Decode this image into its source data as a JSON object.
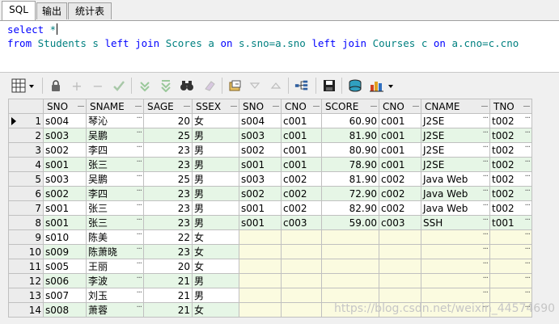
{
  "tabs": [
    "SQL",
    "输出",
    "统计表"
  ],
  "editor": {
    "line1": {
      "kw": "select",
      "rest": " *"
    },
    "line2": [
      "from",
      " ",
      "Students",
      " s ",
      "left join",
      " ",
      "Scores",
      " a ",
      "on",
      " s.sno=a.sno ",
      "left join",
      " ",
      "Courses",
      " c ",
      "on",
      " a.cno=c.cno"
    ]
  },
  "columns": [
    "SNO",
    "SNAME",
    "SAGE",
    "SSEX",
    "SNO",
    "CNO",
    "SCORE",
    "CNO",
    "CNAME",
    "TNO"
  ],
  "rows": [
    [
      "1",
      "s004",
      "琴沁",
      "20",
      "女",
      "s004",
      "c001",
      "60.90",
      "c001",
      "J2SE",
      "t002"
    ],
    [
      "2",
      "s003",
      "吴鹏",
      "25",
      "男",
      "s003",
      "c001",
      "81.90",
      "c001",
      "J2SE",
      "t002"
    ],
    [
      "3",
      "s002",
      "李四",
      "23",
      "男",
      "s002",
      "c001",
      "80.90",
      "c001",
      "J2SE",
      "t002"
    ],
    [
      "4",
      "s001",
      "张三",
      "23",
      "男",
      "s001",
      "c001",
      "78.90",
      "c001",
      "J2SE",
      "t002"
    ],
    [
      "5",
      "s003",
      "吴鹏",
      "25",
      "男",
      "s003",
      "c002",
      "81.90",
      "c002",
      "Java Web",
      "t002"
    ],
    [
      "6",
      "s002",
      "李四",
      "23",
      "男",
      "s002",
      "c002",
      "72.90",
      "c002",
      "Java Web",
      "t002"
    ],
    [
      "7",
      "s001",
      "张三",
      "23",
      "男",
      "s001",
      "c002",
      "82.90",
      "c002",
      "Java Web",
      "t002"
    ],
    [
      "8",
      "s001",
      "张三",
      "23",
      "男",
      "s001",
      "c003",
      "59.00",
      "c003",
      "SSH",
      "t001"
    ],
    [
      "9",
      "s010",
      "陈美",
      "22",
      "女",
      "",
      "",
      "",
      "",
      "",
      ""
    ],
    [
      "10",
      "s009",
      "陈萧晓",
      "23",
      "女",
      "",
      "",
      "",
      "",
      "",
      ""
    ],
    [
      "11",
      "s005",
      "王丽",
      "20",
      "女",
      "",
      "",
      "",
      "",
      "",
      ""
    ],
    [
      "12",
      "s006",
      "李波",
      "21",
      "男",
      "",
      "",
      "",
      "",
      "",
      ""
    ],
    [
      "13",
      "s007",
      "刘玉",
      "21",
      "男",
      "",
      "",
      "",
      "",
      "",
      ""
    ],
    [
      "14",
      "s008",
      "萧蓉",
      "21",
      "女",
      "",
      "",
      "",
      "",
      "",
      ""
    ]
  ],
  "watermark": "https://blog.csdn.net/weixin_44574690"
}
